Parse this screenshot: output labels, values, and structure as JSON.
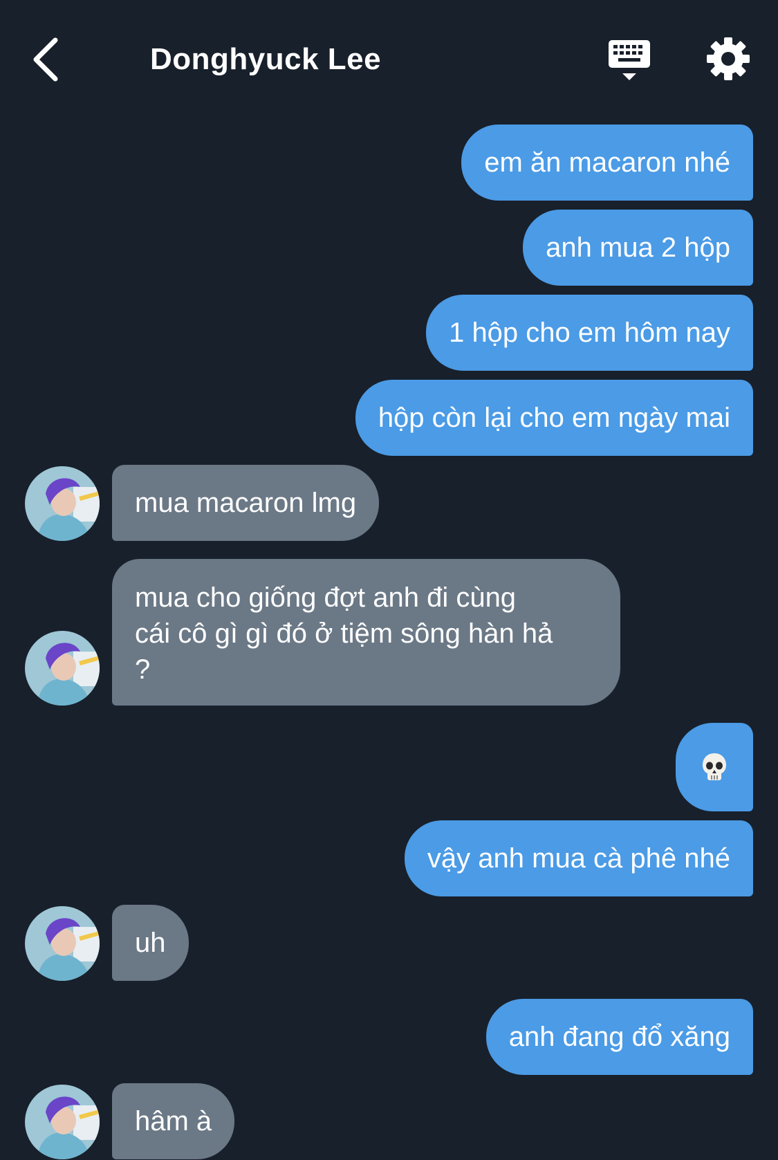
{
  "header": {
    "title": "Donghyuck Lee"
  },
  "messages": [
    {
      "side": "sent",
      "text": "em ăn macaron nhé"
    },
    {
      "side": "sent",
      "text": "anh mua 2 hộp"
    },
    {
      "side": "sent",
      "text": "1 hộp cho em hôm nay"
    },
    {
      "side": "sent",
      "text": "hộp còn lại cho em ngày mai"
    },
    {
      "side": "received",
      "text": "mua macaron lmg"
    },
    {
      "side": "received",
      "lines": [
        "mua cho giống đợt anh đi cùng",
        "cái cô gì gì đó ở tiệm sông hàn hả",
        "?"
      ]
    },
    {
      "side": "sent",
      "text": "💀"
    },
    {
      "side": "sent",
      "text": "vậy anh mua cà phê nhé"
    },
    {
      "side": "received",
      "text": "uh"
    },
    {
      "side": "sent",
      "text": "anh đang đổ xăng"
    },
    {
      "side": "received",
      "text": "hâm à"
    }
  ],
  "colors": {
    "background": "#18202b",
    "sent_bubble": "#4b9be6",
    "received_bubble": "#6b7886"
  },
  "icons": [
    "back-chevron-icon",
    "keyboard-icon",
    "gear-icon",
    "skull-emoji"
  ]
}
